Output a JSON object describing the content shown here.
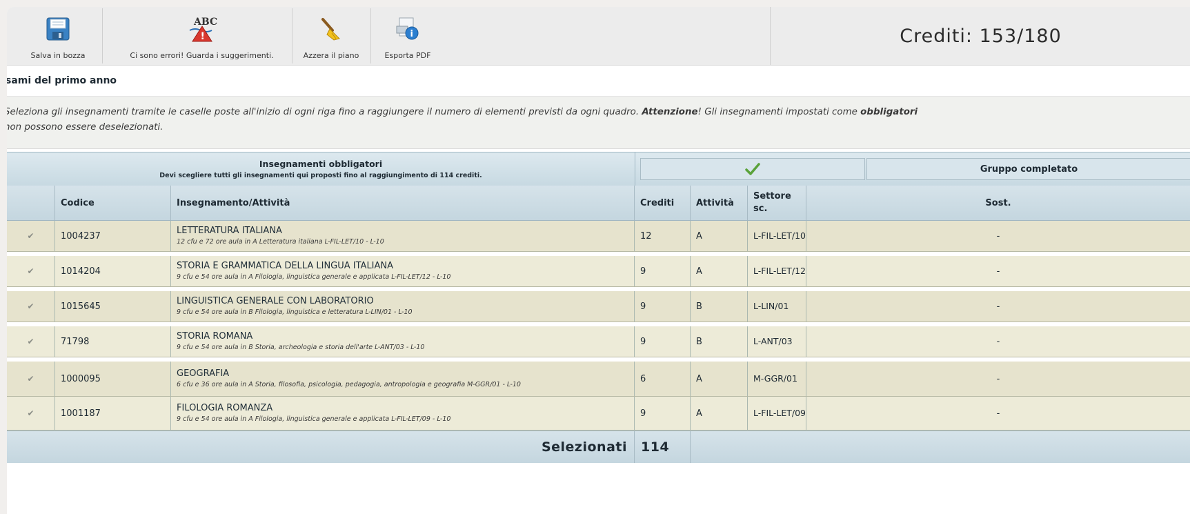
{
  "toolbar": {
    "buttons": [
      {
        "label": "Salva in bozza",
        "icon": "floppy-disk-icon"
      },
      {
        "label": "Ci sono errori! Guarda i suggerimenti.",
        "icon": "abc-warning-icon"
      },
      {
        "label": "Azzera il piano",
        "icon": "broom-icon"
      },
      {
        "label": "Esporta PDF",
        "icon": "pdf-export-icon"
      }
    ],
    "icon_text_abc": "ABC",
    "credits": "Crediti: 153/180"
  },
  "section": {
    "title": "sami del primo anno",
    "instructions": {
      "part1": "Seleziona gli insegnamenti tramite le caselle poste all'inizio di ogni riga fino a raggiungere il numero di elementi previsti da ogni quadro. ",
      "bold1": "Attenzione",
      "part2": "! Gli insegnamenti impostati come ",
      "bold2": "obbligatori",
      "line2": "non possono essere deselezionati."
    }
  },
  "group": {
    "title": "Insegnamenti obbligatori",
    "subtitle": "Devi scegliere tutti gli insegnamenti qui proposti fino al raggiungimento di 114 crediti.",
    "status_icon": "check-icon",
    "status_text": "Gruppo completato"
  },
  "columns": {
    "codice": "Codice",
    "insegnamento": "Insegnamento/Attività",
    "crediti": "Crediti",
    "attivita": "Attività",
    "settore": "Settore sc.",
    "sost": "Sost."
  },
  "rows": [
    {
      "check": "✔",
      "codice": "1004237",
      "name": "LETTERATURA ITALIANA",
      "detail": "12 cfu e 72 ore aula in A Letteratura italiana L-FIL-LET/10 - L-10",
      "crediti": "12",
      "attivita": "A",
      "settore": "L-FIL-LET/10",
      "sost": "-"
    },
    {
      "check": "✔",
      "codice": "1014204",
      "name": "STORIA E GRAMMATICA DELLA LINGUA ITALIANA",
      "detail": "9 cfu e 54 ore aula in A Filologia, linguistica generale e applicata L-FIL-LET/12 - L-10",
      "crediti": "9",
      "attivita": "A",
      "settore": "L-FIL-LET/12",
      "sost": "-"
    },
    {
      "check": "✔",
      "codice": "1015645",
      "name": "LINGUISTICA GENERALE CON LABORATORIO",
      "detail": "9 cfu e 54 ore aula in B Filologia, linguistica e letteratura L-LIN/01 - L-10",
      "crediti": "9",
      "attivita": "B",
      "settore": "L-LIN/01",
      "sost": "-"
    },
    {
      "check": "✔",
      "codice": "71798",
      "name": "STORIA ROMANA",
      "detail": "9 cfu e 54 ore aula in B Storia, archeologia e storia dell'arte L-ANT/03 - L-10",
      "crediti": "9",
      "attivita": "B",
      "settore": "L-ANT/03",
      "sost": "-"
    },
    {
      "check": "✔",
      "codice": "1000095",
      "name": "GEOGRAFIA",
      "detail": "6 cfu e 36 ore aula in A Storia, filosofia, psicologia, pedagogia, antropologia e geografia M-GGR/01 - L-10",
      "crediti": "6",
      "attivita": "A",
      "settore": "M-GGR/01",
      "sost": "-"
    },
    {
      "check": "✔",
      "codice": "1001187",
      "name": "FILOLOGIA ROMANZA",
      "detail": "9 cfu e 54 ore aula in A Filologia, linguistica generale e applicata L-FIL-LET/09 - L-10",
      "crediti": "9",
      "attivita": "A",
      "settore": "L-FIL-LET/09",
      "sost": "-"
    }
  ],
  "footer": {
    "label": "Selezionati",
    "value": "114"
  },
  "colors": {
    "header_blue": "#c7d9e2",
    "row_beige": "#e6e3cd",
    "check_green": "#5aa23a"
  }
}
